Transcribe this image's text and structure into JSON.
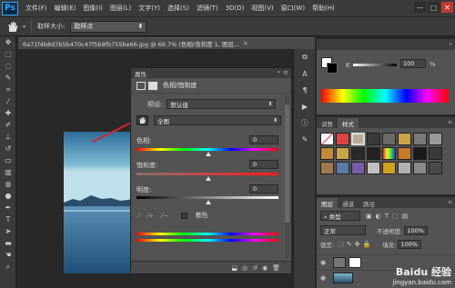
{
  "app": {
    "logo": "Ps"
  },
  "menu": [
    "文件(F)",
    "编辑(E)",
    "图像(I)",
    "图层(L)",
    "文字(Y)",
    "选择(S)",
    "滤镜(T)",
    "3D(D)",
    "视图(V)",
    "窗口(W)",
    "帮助(H)"
  ],
  "window_controls": {
    "minimize": "—",
    "restore": "□",
    "close": "✕"
  },
  "options_bar": {
    "sample_label": "取样大小:",
    "sample_value": "取样点"
  },
  "document": {
    "tab_title": "6a71f4b8d7b5b470c47f5b9fb755be66.jpg @ 66.7% (色相/饱和度 1, 图层...",
    "close": "✕"
  },
  "properties": {
    "panel_title": "属性",
    "adjustment_name": "色相/饱和度",
    "preset_label": "预设:",
    "preset_value": "默认值",
    "channel_value": "全图",
    "hue_label": "色相:",
    "hue_value": "0",
    "saturation_label": "饱和度:",
    "saturation_value": "0",
    "lightness_label": "明度:",
    "lightness_value": "0",
    "colorize_label": "着色"
  },
  "color_panel": {
    "opacity_label": "K",
    "value": "100",
    "unit": "%"
  },
  "adjust_panel": {
    "tab_adjust": "调整",
    "tab_styles": "样式"
  },
  "layers_panel": {
    "tab_layers": "图层",
    "tab_channels": "通道",
    "tab_paths": "路径",
    "kind_label": "类型",
    "blend_mode": "正常",
    "opacity_label": "不透明度:",
    "opacity_value": "100%",
    "lock_label": "锁定:",
    "fill_label": "填充:",
    "fill_value": "100%"
  },
  "watermark": {
    "brand": "Baidu 经验",
    "url": "jingyan.baidu.com"
  },
  "colors": {
    "accent_red": "#d8232a",
    "panel_bg": "#535353",
    "chrome_bg": "#3b3b3b",
    "canvas_bg": "#282828"
  },
  "icons": [
    "hand-icon",
    "eyedropper-icon",
    "marquee-icon",
    "lasso-icon",
    "crop-icon",
    "brush-icon",
    "eye-icon",
    "trash-icon"
  ]
}
